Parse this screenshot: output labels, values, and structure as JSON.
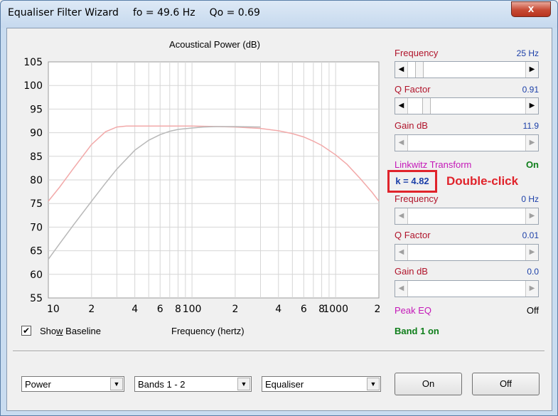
{
  "window": {
    "title": "Equaliser Filter Wizard",
    "fo": "fo = 49.6 Hz",
    "qo": "Qo = 0.69",
    "close_glyph": "x"
  },
  "chart_data": {
    "type": "line",
    "title": "Acoustical Power (dB)",
    "xlabel": "Frequency (hertz)",
    "ylabel": "",
    "x_scale": "log",
    "xlim": [
      10,
      2000
    ],
    "ylim": [
      55,
      105
    ],
    "y_ticks": [
      "105",
      "100",
      "95",
      "90",
      "85",
      "80",
      "75",
      "70",
      "65",
      "60",
      "55"
    ],
    "x_ticks": [
      "10",
      "2",
      "4",
      "6",
      "8",
      "100",
      "2",
      "4",
      "6",
      "8",
      "1000",
      "2"
    ],
    "grid": true,
    "series": [
      {
        "color": "#f2a9a9",
        "x": [
          10,
          12,
          15,
          20,
          25,
          30,
          35,
          40,
          50,
          70,
          100,
          150,
          200,
          300,
          400,
          500,
          600,
          700,
          800,
          1000,
          1200,
          1500,
          1800,
          2000
        ],
        "y": [
          75.5,
          78.5,
          82.5,
          87.5,
          90.2,
          91.2,
          91.4,
          91.4,
          91.4,
          91.4,
          91.4,
          91.3,
          91.2,
          90.9,
          90.4,
          89.8,
          89.1,
          88.2,
          87.3,
          85.3,
          83.3,
          80.1,
          77.3,
          75.5
        ]
      },
      {
        "color": "#b8b8b8",
        "x": [
          10,
          12,
          15,
          20,
          25,
          30,
          40,
          50,
          60,
          70,
          80,
          100,
          120,
          150,
          200,
          300
        ],
        "y": [
          63.2,
          66.5,
          70.5,
          75.5,
          79.3,
          82.3,
          86.3,
          88.4,
          89.6,
          90.3,
          90.7,
          91.0,
          91.2,
          91.3,
          91.3,
          91.2
        ]
      }
    ]
  },
  "baseline": {
    "label_pre": "Sho",
    "label_u": "w",
    "label_post": " Baseline",
    "checked_glyph": "✔"
  },
  "right_panel": {
    "band1": {
      "frequency": {
        "label": "Frequency",
        "value": "25 Hz",
        "thumb": 0.08
      },
      "q_factor": {
        "label": "Q Factor",
        "value": "0.91",
        "thumb": 0.15
      },
      "gain": {
        "label": "Gain  dB",
        "value": "11.9"
      }
    },
    "linkwitz": {
      "label": "Linkwitz Transform",
      "value": "On",
      "k": "k = 4.82",
      "annotation": "Double-click"
    },
    "band2": {
      "frequency": {
        "label": "Frequency",
        "value": "0 Hz"
      },
      "q_factor": {
        "label": "Q Factor",
        "value": "0.01"
      },
      "gain": {
        "label": "Gain  dB",
        "value": "0.0"
      }
    },
    "peak_eq": {
      "label": "Peak EQ",
      "value": "Off"
    },
    "band_status": "Band 1 on"
  },
  "bottom": {
    "combo_power": "Power",
    "combo_bands": "Bands 1 - 2",
    "combo_mode": "Equaliser",
    "on_button": "On",
    "off_button": "Off",
    "arrow_glyph": "▼"
  },
  "icons": {
    "left_arrow": "◀",
    "right_arrow": "▶"
  }
}
